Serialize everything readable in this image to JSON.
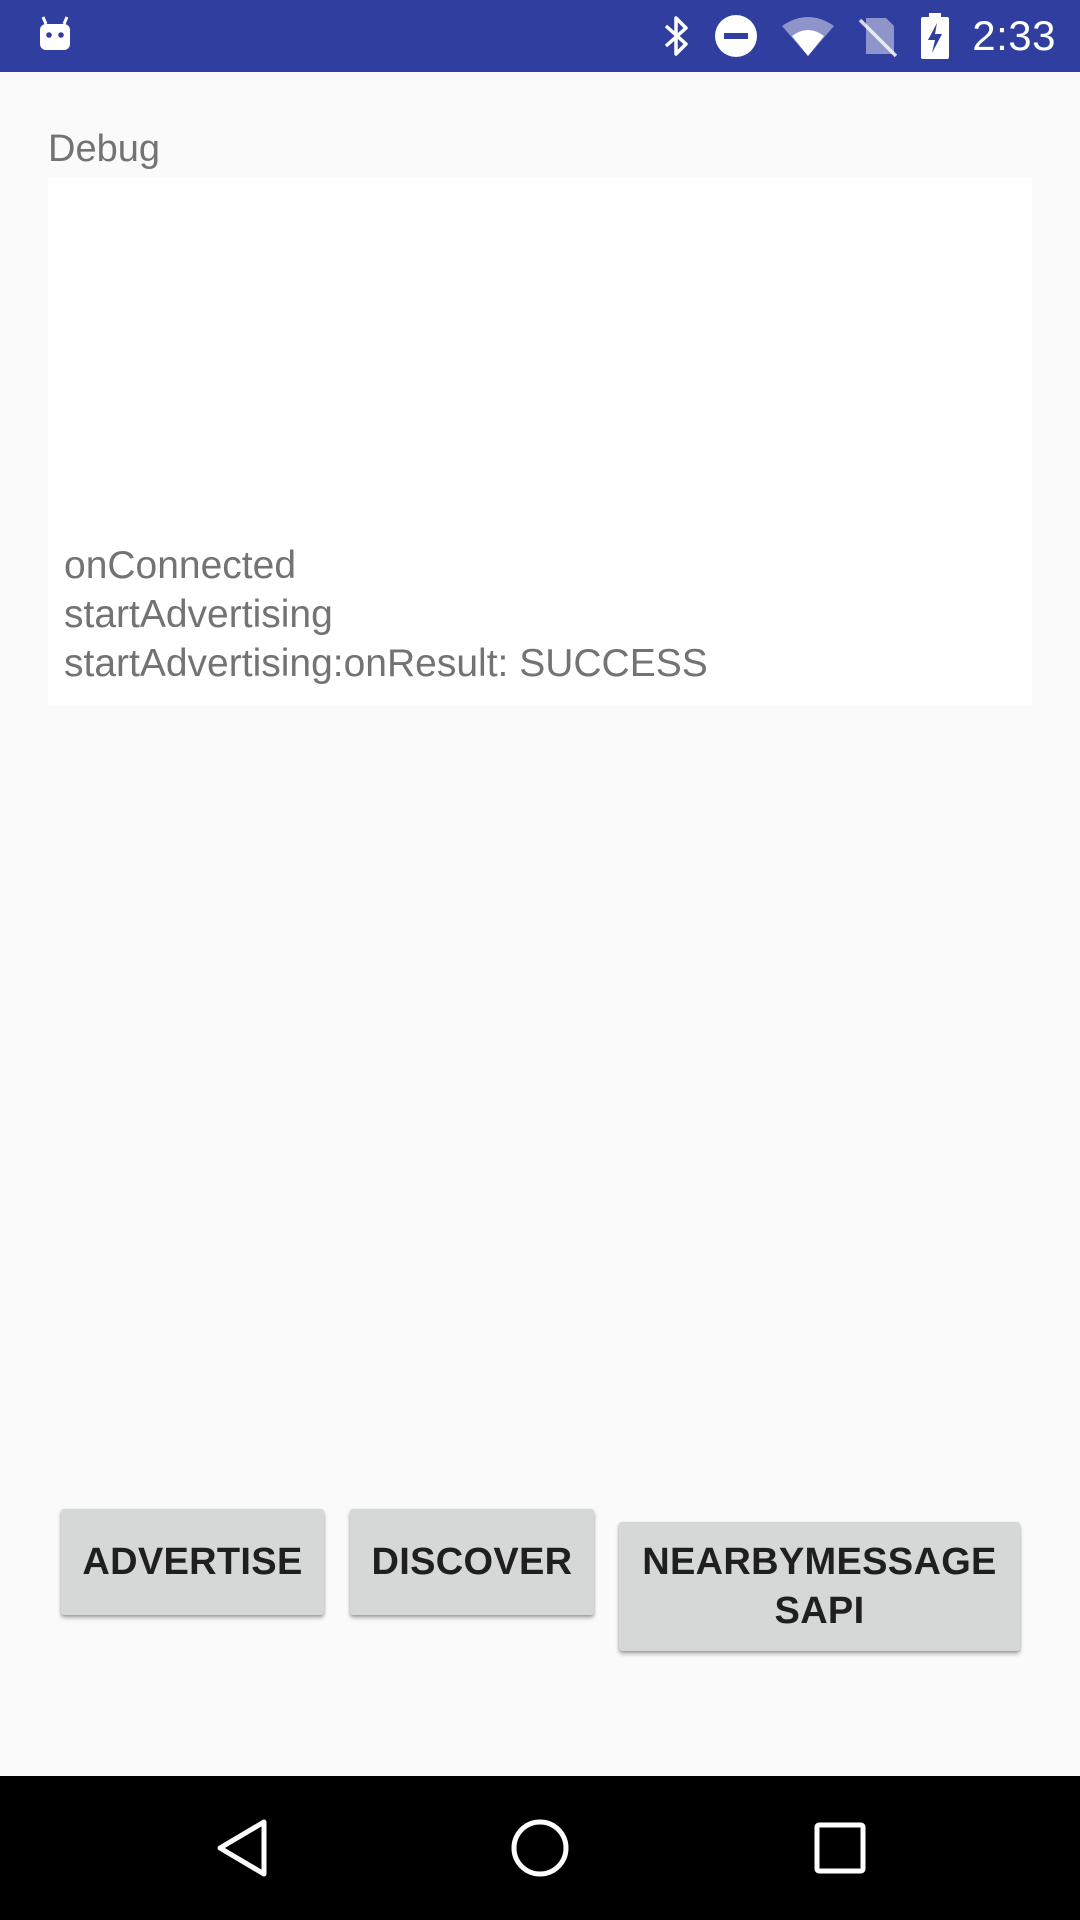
{
  "status_bar": {
    "clock": "2:33",
    "icons": [
      "android-app-icon",
      "bluetooth-icon",
      "do-not-disturb-icon",
      "wifi-icon",
      "no-sim-icon",
      "battery-charging-icon"
    ],
    "background_color": "#303f9f"
  },
  "debug": {
    "label": "Debug",
    "lines": [
      "onConnected",
      "startAdvertising",
      "startAdvertising:onResult: SUCCESS"
    ]
  },
  "buttons": {
    "advertise": "ADVERTISE",
    "discover": "DISCOVER",
    "nearby_line1": "NEARBYMESSAGE",
    "nearby_line2": "SAPI"
  },
  "nav_bar": {
    "icons": [
      "back-icon",
      "home-icon",
      "recents-icon"
    ]
  }
}
